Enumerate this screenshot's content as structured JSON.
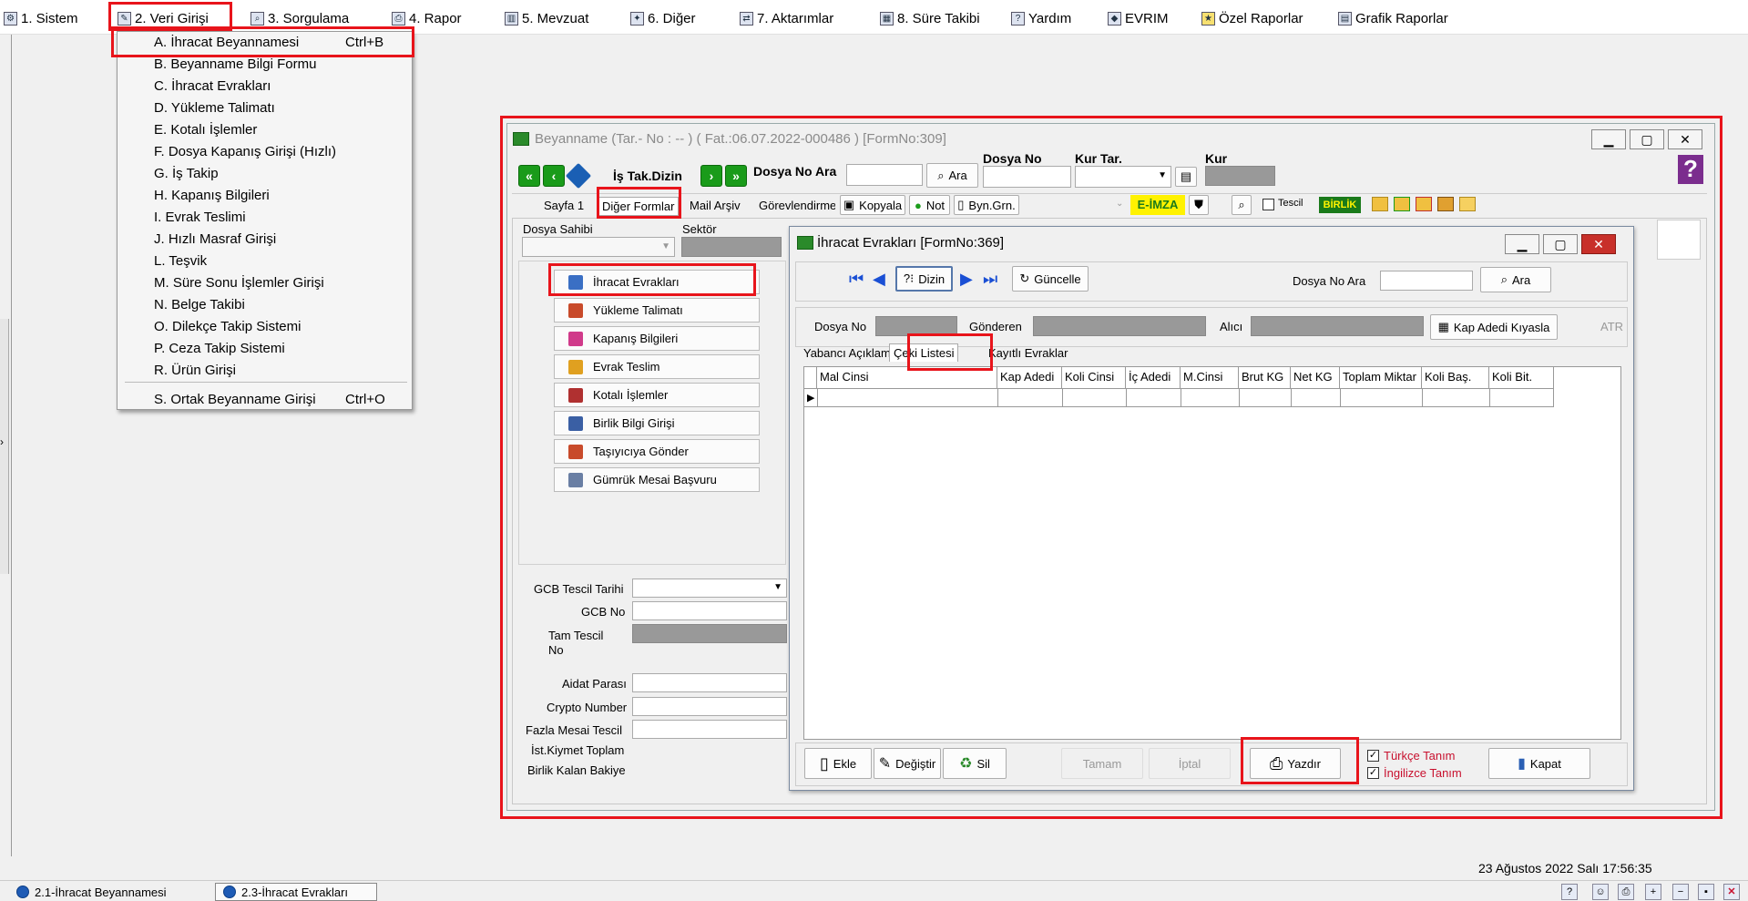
{
  "menubar": {
    "items": [
      {
        "label": "1.  Sistem",
        "icon": "system-icon"
      },
      {
        "label": "2.  Veri Girişi",
        "icon": "data-entry-icon"
      },
      {
        "label": "3.  Sorgulama",
        "icon": "query-icon"
      },
      {
        "label": "4.  Rapor",
        "icon": "printer-icon"
      },
      {
        "label": "5.  Mevzuat",
        "icon": "books-icon"
      },
      {
        "label": "6.  Diğer",
        "icon": "tools-icon"
      },
      {
        "label": "7.  Aktarımlar",
        "icon": "transfer-icon"
      },
      {
        "label": "8. Süre Takibi",
        "icon": "calendar-icon"
      },
      {
        "label": "Yardım",
        "icon": "help-icon"
      },
      {
        "label": "EVRIM",
        "icon": "evrim-icon"
      },
      {
        "label": "Özel Raporlar",
        "icon": "star-icon"
      },
      {
        "label": "Grafik Raporlar",
        "icon": "chart-icon"
      }
    ]
  },
  "dropdown": {
    "items": [
      {
        "label": "A.  İhracat Beyannamesi",
        "shortcut": "Ctrl+B"
      },
      {
        "label": "B.  Beyanname Bilgi Formu",
        "shortcut": ""
      },
      {
        "label": "C.  İhracat Evrakları",
        "shortcut": ""
      },
      {
        "label": "D.  Yükleme Talimatı",
        "shortcut": ""
      },
      {
        "label": "E.  Kotalı İşlemler",
        "shortcut": ""
      },
      {
        "label": "F.  Dosya Kapanış Girişi (Hızlı)",
        "shortcut": ""
      },
      {
        "label": "G.  İş Takip",
        "shortcut": ""
      },
      {
        "label": "H.  Kapanış Bilgileri",
        "shortcut": ""
      },
      {
        "label": "I.  Evrak Teslimi",
        "shortcut": ""
      },
      {
        "label": "J.  Hızlı Masraf Girişi",
        "shortcut": ""
      },
      {
        "label": "L.  Teşvik",
        "shortcut": ""
      },
      {
        "label": "M.  Süre Sonu İşlemler Girişi",
        "shortcut": ""
      },
      {
        "label": "N.  Belge Takibi",
        "shortcut": ""
      },
      {
        "label": "O.  Dilekçe Takip Sistemi",
        "shortcut": ""
      },
      {
        "label": "P.  Ceza Takip Sistemi",
        "shortcut": ""
      },
      {
        "label": "R.  Ürün Girişi",
        "shortcut": ""
      },
      {
        "label": "S.  Ortak Beyanname Girişi",
        "shortcut": "Ctrl+O"
      }
    ]
  },
  "beyanname": {
    "title": "Beyanname (Tar.- No :  --  ) ( Fat.:06.07.2022-000486 )  [FormNo:309]",
    "is_tak_dizin": "İş Tak.Dizin",
    "dosya_no_ara": "Dosya No Ara",
    "ara": "Ara",
    "dosya_no_label": "Dosya No",
    "kur_tar_label": "Kur Tar.",
    "kur_label": "Kur",
    "tabs": [
      "Sayfa 1",
      "Diğer Formlar",
      "Mail Arşiv",
      "Görevlendirme"
    ],
    "toolbar": {
      "kopyala": "Kopyala",
      "not": "Not",
      "byn_grn": "Byn.Grn.",
      "eimza": "E-İMZA",
      "tescil": "Tescil",
      "birlik": "BİRLİK"
    },
    "dosya_sahibi": "Dosya Sahibi",
    "sektor": "Sektör",
    "side_buttons": [
      "İhracat Evrakları",
      "Yükleme Talimatı",
      "Kapanış Bilgileri",
      "Evrak Teslim",
      "Kotalı İşlemler",
      "Birlik Bilgi Girişi",
      "Taşıyıcıya Gönder",
      "Gümrük Mesai Başvuru"
    ],
    "fields": {
      "gcb_tescil_tarihi": "GCB Tescil Tarihi",
      "gcb_no": "GCB No",
      "tam_tescil_no": "Tam Tescil No",
      "aidat_parasi": "Aidat Parası",
      "crypto_number": "Crypto Number",
      "fazla_mesai_tescil": "Fazla Mesai Tescil",
      "ist_kiymet_toplam": "İst.Kiymet Toplam",
      "birlik_kalan_bakiye": "Birlik Kalan Bakiye"
    }
  },
  "ihracat": {
    "title": "İhracat Evrakları [FormNo:369]",
    "dizin": "Dizin",
    "guncelle": "Güncelle",
    "dosya_no_ara": "Dosya No Ara",
    "ara": "Ara",
    "dosya_no": "Dosya No",
    "gonderen": "Gönderen",
    "alici": "Alıcı",
    "kap_adedi_kiyasla": "Kap Adedi Kıyasla",
    "atr": "ATR",
    "tabs": [
      "Yabancı Açıklama",
      "Çeki Listesi",
      "Kayıtlı Evraklar"
    ],
    "columns": [
      "Mal Cinsi",
      "Kap Adedi",
      "Koli Cinsi",
      "İç Adedi",
      "M.Cinsi",
      "Brut KG",
      "Net KG",
      "Toplam Miktar",
      "Koli Baş.",
      "Koli Bit."
    ],
    "buttons": {
      "ekle": "Ekle",
      "degistir": "Değiştir",
      "sil": "Sil",
      "tamam": "Tamam",
      "iptal": "İptal",
      "yazdir": "Yazdır",
      "kapat": "Kapat"
    },
    "checks": {
      "turkce": "Türkçe Tanım",
      "ingilizce": "İngilizce Tanım"
    }
  },
  "status": {
    "datetime": "23 Ağustos 2022 Salı 17:56:35"
  },
  "taskbar": {
    "tasks": [
      "2.1-İhracat Beyannamesi",
      "2.3-İhracat Evrakları"
    ]
  }
}
